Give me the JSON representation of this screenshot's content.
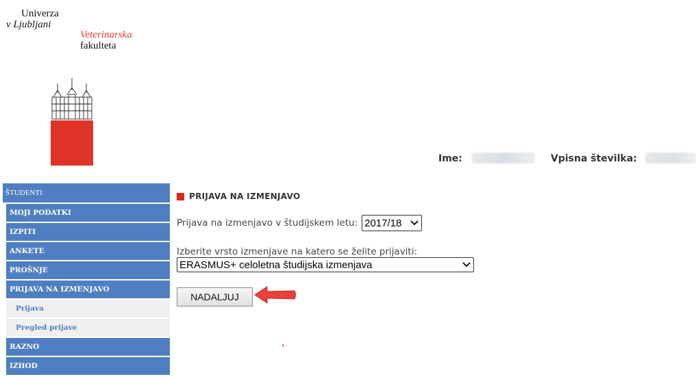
{
  "logo": {
    "line1": "Univerza",
    "line2": "v Ljubljani",
    "faculty1": "Veterinarska",
    "faculty2": "fakulteta"
  },
  "user": {
    "name_label": "Ime:",
    "enrollment_label": "Vpisna številka:"
  },
  "sidebar": {
    "header": "ŠTUDENTI",
    "items": [
      {
        "label": "MOJI PODATKI"
      },
      {
        "label": "IZPITI"
      },
      {
        "label": "ANKETE"
      },
      {
        "label": "PROŠNJE"
      },
      {
        "label": "PRIJAVA NA IZMENJAVO"
      }
    ],
    "subitems": [
      {
        "label": "Prijava"
      },
      {
        "label": "Pregled prijave"
      }
    ],
    "bottom_items": [
      {
        "label": "RAZNO"
      },
      {
        "label": "IZHOD"
      }
    ]
  },
  "main": {
    "title": "PRIJAVA NA IZMENJAVO",
    "year_label": "Prijava na izmenjavo v študijskem letu:",
    "year_value": "2017/18",
    "type_label": "Izberite vrsto izmenjave na katero se želite prijaviti:",
    "type_value": "ERASMUS+ celoletna študijska izmenjava",
    "continue_button": "NADALJUJ"
  },
  "colors": {
    "sidebar_blue": "#4f7fc2",
    "accent_red": "#e03429"
  },
  "icons": {
    "chevron": "chevron-down-icon",
    "arrow": "red-arrow-icon"
  }
}
